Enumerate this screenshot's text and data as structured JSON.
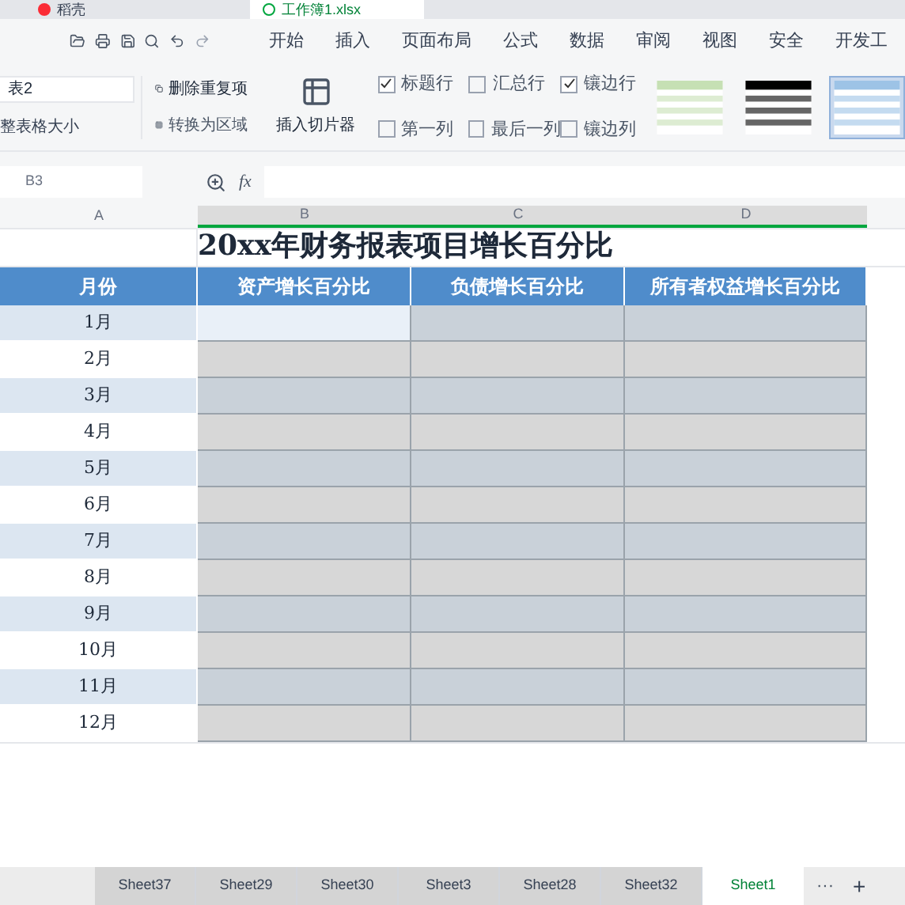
{
  "doc_tabs": [
    {
      "title": "稻壳",
      "selected": false
    },
    {
      "title": "工作簿1.xlsx",
      "selected": true
    }
  ],
  "menu": [
    {
      "label": "开始",
      "selected": false
    },
    {
      "label": "插入",
      "selected": false
    },
    {
      "label": "页面布局",
      "selected": false
    },
    {
      "label": "公式",
      "selected": false
    },
    {
      "label": "数据",
      "selected": false
    },
    {
      "label": "审阅",
      "selected": false
    },
    {
      "label": "视图",
      "selected": false
    },
    {
      "label": "安全",
      "selected": false
    },
    {
      "label": "开发工",
      "selected": false
    }
  ],
  "ribbon": {
    "table_name": "表2",
    "resize": "整表格大小",
    "remove_duplicates": "删除重复项",
    "to_range": "转换为区域",
    "slicer": "插入切片器",
    "options": [
      {
        "label": "标题行",
        "checked": true
      },
      {
        "label": "汇总行",
        "checked": false
      },
      {
        "label": "镶边行",
        "checked": true
      },
      {
        "label": "第一列",
        "checked": false
      },
      {
        "label": "最后一列",
        "checked": false
      },
      {
        "label": "镶边列",
        "checked": false
      }
    ],
    "styles": [
      {
        "color": "#c6e0b4",
        "selected": false
      },
      {
        "color": "#000000",
        "selected": false
      },
      {
        "color": "#9dc3e6",
        "selected": true
      }
    ]
  },
  "name_box": "B3",
  "fx": "fx",
  "columns": [
    "A",
    "B",
    "C",
    "D"
  ],
  "title": "20xx年财务报表项目增长百分比",
  "headers": [
    "月份",
    "资产增长百分比",
    "负债增长百分比",
    "所有者权益增长百分比"
  ],
  "rows": [
    {
      "month": "1月",
      "banded": true,
      "cells": [
        {
          "selected": true
        },
        {
          "selected": false
        },
        {
          "selected": false
        }
      ]
    },
    {
      "month": "2月",
      "banded": false,
      "cells": [
        {
          "selected": false
        },
        {
          "selected": false
        },
        {
          "selected": false
        }
      ]
    },
    {
      "month": "3月",
      "banded": true,
      "cells": [
        {
          "selected": false
        },
        {
          "selected": false
        },
        {
          "selected": false
        }
      ]
    },
    {
      "month": "4月",
      "banded": false,
      "cells": [
        {
          "selected": false
        },
        {
          "selected": false
        },
        {
          "selected": false
        }
      ]
    },
    {
      "month": "5月",
      "banded": true,
      "cells": [
        {
          "selected": false
        },
        {
          "selected": false
        },
        {
          "selected": false
        }
      ]
    },
    {
      "month": "6月",
      "banded": false,
      "cells": [
        {
          "selected": false
        },
        {
          "selected": false
        },
        {
          "selected": false
        }
      ]
    },
    {
      "month": "7月",
      "banded": true,
      "cells": [
        {
          "selected": false
        },
        {
          "selected": false
        },
        {
          "selected": false
        }
      ]
    },
    {
      "month": "8月",
      "banded": false,
      "cells": [
        {
          "selected": false
        },
        {
          "selected": false
        },
        {
          "selected": false
        }
      ]
    },
    {
      "month": "9月",
      "banded": true,
      "cells": [
        {
          "selected": false
        },
        {
          "selected": false
        },
        {
          "selected": false
        }
      ]
    },
    {
      "month": "10月",
      "banded": false,
      "cells": [
        {
          "selected": false
        },
        {
          "selected": false
        },
        {
          "selected": false
        }
      ]
    },
    {
      "month": "11月",
      "banded": true,
      "cells": [
        {
          "selected": false
        },
        {
          "selected": false
        },
        {
          "selected": false
        }
      ]
    },
    {
      "month": "12月",
      "banded": false,
      "cells": [
        {
          "selected": false
        },
        {
          "selected": false
        },
        {
          "selected": false
        }
      ]
    }
  ],
  "sheets": [
    {
      "label": "Sheet37",
      "selected": false
    },
    {
      "label": "Sheet29",
      "selected": false
    },
    {
      "label": "Sheet30",
      "selected": false
    },
    {
      "label": "Sheet3",
      "selected": false
    },
    {
      "label": "Sheet28",
      "selected": false
    },
    {
      "label": "Sheet32",
      "selected": false
    },
    {
      "label": "Sheet1",
      "selected": true
    }
  ],
  "more_sheets": "···",
  "add_sheet": "+"
}
